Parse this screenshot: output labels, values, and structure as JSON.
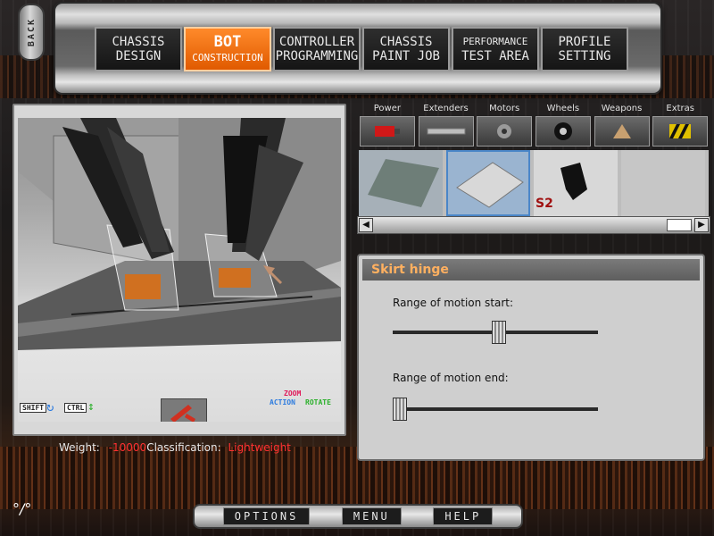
{
  "nav": {
    "back": "BACK",
    "tabs": [
      {
        "line1": "CHASSIS",
        "line2": "DESIGN"
      },
      {
        "line1": "BOT",
        "line2": "CONSTRUCTION"
      },
      {
        "line1": "CONTROLLER",
        "line2": "PROGRAMMING"
      },
      {
        "line1": "CHASSIS",
        "line2": "PAINT JOB"
      },
      {
        "line1": "PERFORMANCE",
        "line2": "TEST AREA"
      },
      {
        "line1": "PROFILE",
        "line2": "SETTING"
      }
    ],
    "active_tab": "BOT CONSTRUCTION"
  },
  "viewport": {
    "hud": {
      "shift": "SHIFT",
      "ctrl": "CTRL",
      "action": "ACTION",
      "zoom": "ZOOM",
      "rotate": "ROTATE"
    }
  },
  "info": {
    "weight_label": "Weight:",
    "weight_value": "-10000",
    "class_label": "Classification:",
    "class_value": "Lightweight"
  },
  "categories": [
    {
      "label": "Power",
      "icon": "battery-icon"
    },
    {
      "label": "Extenders",
      "icon": "extender-bar-icon"
    },
    {
      "label": "Motors",
      "icon": "motor-icon"
    },
    {
      "label": "Wheels",
      "icon": "wheel-icon"
    },
    {
      "label": "Weapons",
      "icon": "weapon-icon"
    },
    {
      "label": "Extras",
      "icon": "hazard-icon"
    }
  ],
  "parts": {
    "items": [
      "plate-part",
      "skirt-plate-part",
      "skirt-hinge-part",
      "empty-slot"
    ],
    "part_label": "S2"
  },
  "properties": {
    "title": "Skirt hinge",
    "sliders": [
      {
        "label": "Range of motion start:",
        "value": 0.52
      },
      {
        "label": "Range of motion end:",
        "value": 0.0
      }
    ]
  },
  "bottom": {
    "options": "OPTIONS",
    "menu": "MENU",
    "help": "HELP"
  },
  "colors": {
    "accent": "#ff7a1a",
    "warning": "#ff3030",
    "selection": "#4a86c8"
  }
}
